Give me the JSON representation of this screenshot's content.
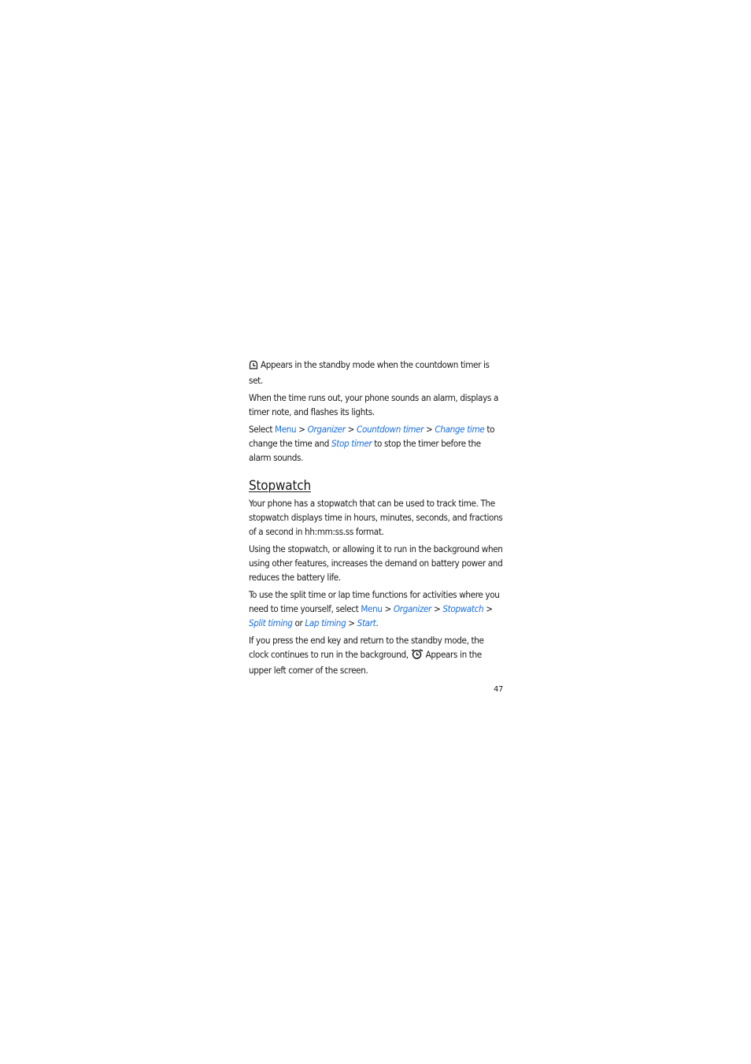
{
  "section_countdown": {
    "icon_note": {
      "icon": "countdown-timer-icon",
      "text": " Appears in the standby mode when the countdown timer is set."
    },
    "para_alarm": "When the time runs out, your phone sounds an alarm, displays a timer note, and flashes its lights.",
    "para_select": {
      "prefix": "Select ",
      "menu": "Menu",
      "sep1": " > ",
      "organizer": "Organizer",
      "sep2": " > ",
      "countdown_timer": "Countdown timer",
      "sep3": " > ",
      "change_time": "Change time",
      "mid": " to change the time and ",
      "stop_timer": "Stop timer",
      "suffix": " to stop the timer before the alarm sounds."
    }
  },
  "section_stopwatch": {
    "heading": "Stopwatch",
    "para_intro": "Your phone has a stopwatch that can be used to track time. The stopwatch displays time in hours, minutes, seconds, and fractions of a second in hh:mm:ss.ss format.",
    "para_battery": "Using the stopwatch, or allowing it to run in the background when using other features, increases the demand on battery power and reduces the battery life.",
    "para_split": {
      "prefix": "To use the split time or lap time functions for activities where you need to time yourself, select ",
      "menu": "Menu",
      "sep1": " > ",
      "organizer": "Organizer",
      "sep2": " > ",
      "stopwatch": "Stopwatch",
      "sep3": " > ",
      "split_timing": "Split timing",
      "or": " or ",
      "lap_timing": "Lap timing",
      "sep4": " > ",
      "start": "Start",
      "suffix": "."
    },
    "para_background": {
      "prefix": "If you press the end key and return to the standby mode, the clock continues to run in the background, ",
      "icon": "stopwatch-icon",
      "suffix": " Appears in the upper left corner of the screen."
    }
  },
  "footer": {
    "page_number": "47"
  },
  "colors": {
    "link": "#1b6fe0",
    "text": "#1a1a1a",
    "background": "#ffffff"
  }
}
